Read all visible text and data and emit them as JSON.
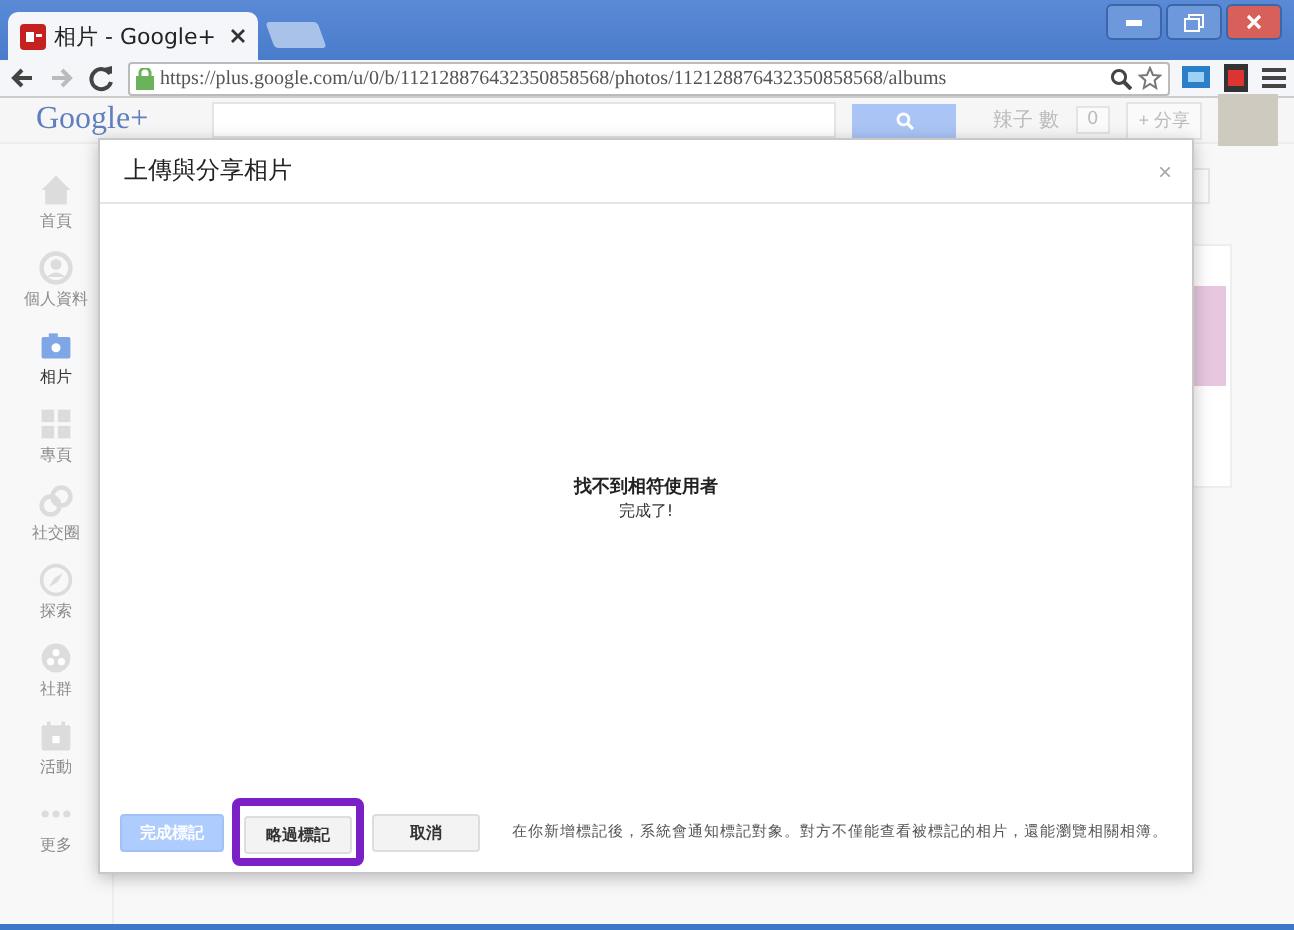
{
  "browser": {
    "tab_title": "相片 - Google+",
    "address": "https://plus.google.com/u/0/b/112128876432350858568/photos/112128876432350858568/albums"
  },
  "header": {
    "logo": "Google+",
    "user_name": "辣子 數",
    "notification_count": "0",
    "share_button": "+ 分享"
  },
  "sidebar": {
    "items": [
      {
        "label": "首頁",
        "selected": false
      },
      {
        "label": "個人資料",
        "selected": false
      },
      {
        "label": "相片",
        "selected": true
      },
      {
        "label": "專頁",
        "selected": false
      },
      {
        "label": "社交圈",
        "selected": false
      },
      {
        "label": "探索",
        "selected": false
      },
      {
        "label": "社群",
        "selected": false
      },
      {
        "label": "活動",
        "selected": false
      },
      {
        "label": "更多",
        "selected": false
      }
    ]
  },
  "dialog": {
    "title": "上傳與分享相片",
    "close": "×",
    "message": "找不到相符使用者",
    "submessage": "完成了!",
    "buttons": [
      {
        "label": "完成標記",
        "kind": "primary",
        "disabled": true,
        "highlighted": false
      },
      {
        "label": "略過標記",
        "kind": "default",
        "disabled": false,
        "highlighted": true
      },
      {
        "label": "取消",
        "kind": "default",
        "disabled": false,
        "highlighted": false
      }
    ],
    "note": "在你新增標記後，系統會通知標記對象。對方不僅能查看被標記的相片，還能瀏覽相關相簿。"
  }
}
